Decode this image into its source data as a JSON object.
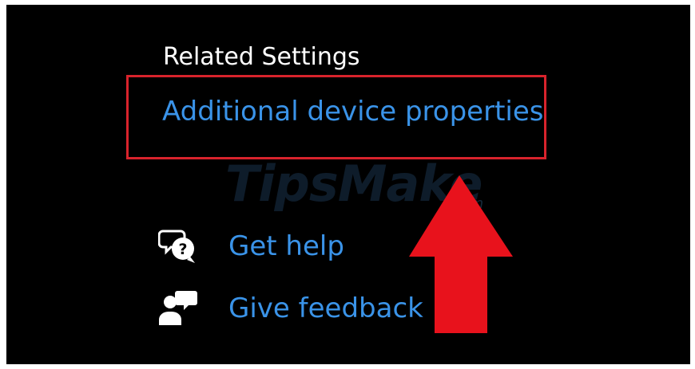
{
  "related_settings": {
    "title": "Related Settings",
    "links": {
      "additional_device_properties": "Additional device properties"
    }
  },
  "support": {
    "get_help": {
      "label": "Get help",
      "icon": "help-chat-icon"
    },
    "give_feedback": {
      "label": "Give feedback",
      "icon": "feedback-person-icon"
    }
  },
  "watermark": {
    "brand": "TipsMake",
    "suffix": ".com"
  },
  "colors": {
    "background": "#000000",
    "link": "#3a93e8",
    "title_text": "#ffffff",
    "highlight": "#d8232c",
    "arrow": "#e8121c"
  }
}
